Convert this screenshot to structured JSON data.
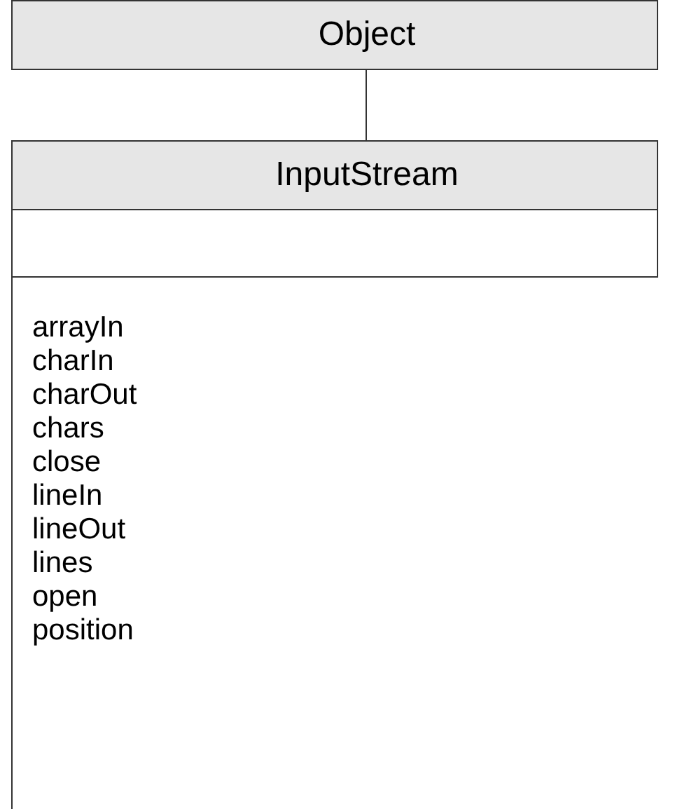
{
  "classes": [
    {
      "name": "Object"
    },
    {
      "name": "InputStream",
      "methods": [
        "arrayIn",
        "charIn",
        "charOut",
        "chars",
        "close",
        "lineIn",
        "lineOut",
        "lines",
        "open",
        "position"
      ]
    }
  ]
}
